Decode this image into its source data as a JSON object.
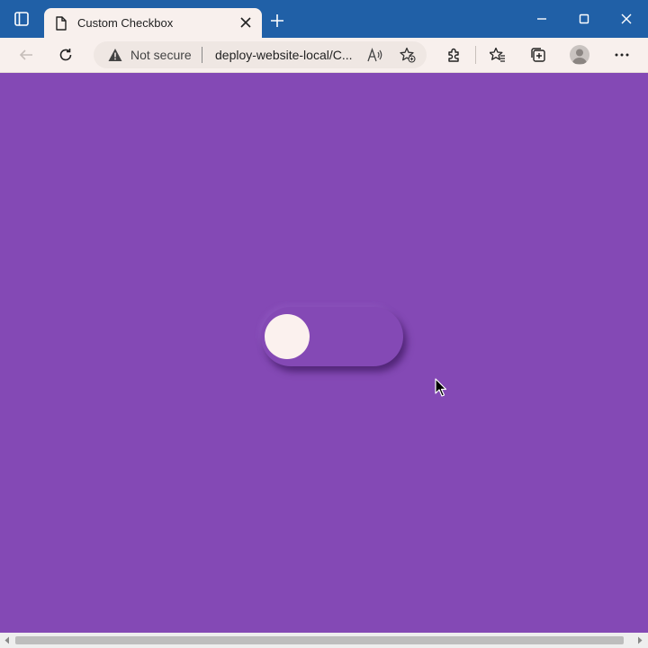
{
  "browser": {
    "tab": {
      "title": "Custom Checkbox"
    },
    "address_bar": {
      "security_label": "Not secure",
      "url": "deploy-website-local/C..."
    }
  },
  "colors": {
    "page_background": "#8449b5",
    "titlebar": "#2060a7",
    "toolbar": "#f8f0ed",
    "toggle_knob": "#fbf1ee"
  },
  "page": {
    "toggle": {
      "state": "off",
      "knob_color_name": "cream"
    }
  },
  "icons": [
    "tab-actions-icon",
    "document-icon",
    "close-icon",
    "plus-icon",
    "minimize-icon",
    "maximize-icon",
    "window-close-icon",
    "back-arrow-icon",
    "refresh-icon",
    "warning-icon",
    "read-aloud-icon",
    "add-favorite-icon",
    "extensions-icon",
    "favorites-icon",
    "collections-icon",
    "profile-icon",
    "more-icon",
    "mouse-cursor-icon"
  ]
}
